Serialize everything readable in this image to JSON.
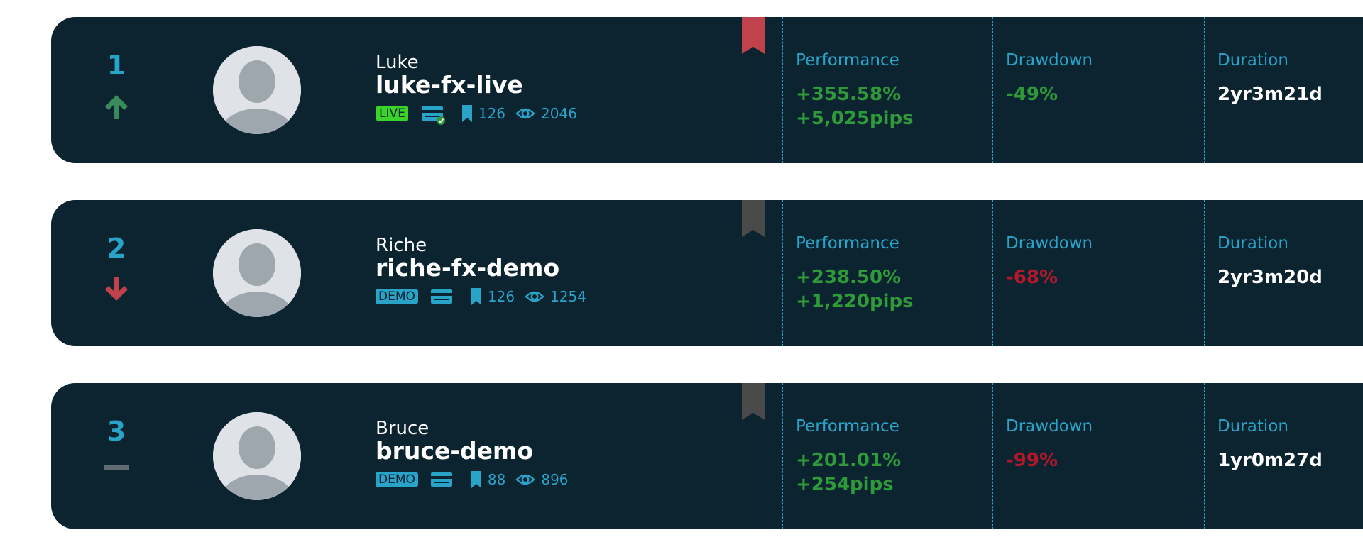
{
  "labels": {
    "performance": "Performance",
    "drawdown": "Drawdown",
    "duration": "Duration"
  },
  "colors": {
    "card_bg": "#0b2430",
    "accent": "#2aa3c9",
    "positive": "#2e9a3a",
    "negative": "#b3182a",
    "live_badge": "#39d32a",
    "ribbon_active": "#c0424c",
    "ribbon_inactive": "#4a4a4a",
    "neutral_trend": "#5f6b70"
  },
  "traders": [
    {
      "rank": "1",
      "trend": "up",
      "display_name": "Luke",
      "account_name": "luke-fx-live",
      "account_type": "LIVE",
      "card_verified": true,
      "bookmarked": true,
      "bookmarks": "126",
      "views": "2046",
      "performance_pct": "+355.58%",
      "performance_pips": "+5,025pips",
      "drawdown": "-49%",
      "drawdown_positive": true,
      "duration": "2yr3m21d"
    },
    {
      "rank": "2",
      "trend": "down",
      "display_name": "Riche",
      "account_name": "riche-fx-demo",
      "account_type": "DEMO",
      "card_verified": false,
      "bookmarked": false,
      "bookmarks": "126",
      "views": "1254",
      "performance_pct": "+238.50%",
      "performance_pips": "+1,220pips",
      "drawdown": "-68%",
      "drawdown_positive": false,
      "duration": "2yr3m20d"
    },
    {
      "rank": "3",
      "trend": "neutral",
      "display_name": "Bruce",
      "account_name": "bruce-demo",
      "account_type": "DEMO",
      "card_verified": false,
      "bookmarked": false,
      "bookmarks": "88",
      "views": "896",
      "performance_pct": "+201.01%",
      "performance_pips": "+254pips",
      "drawdown": "-99%",
      "drawdown_positive": false,
      "duration": "1yr0m27d"
    }
  ]
}
